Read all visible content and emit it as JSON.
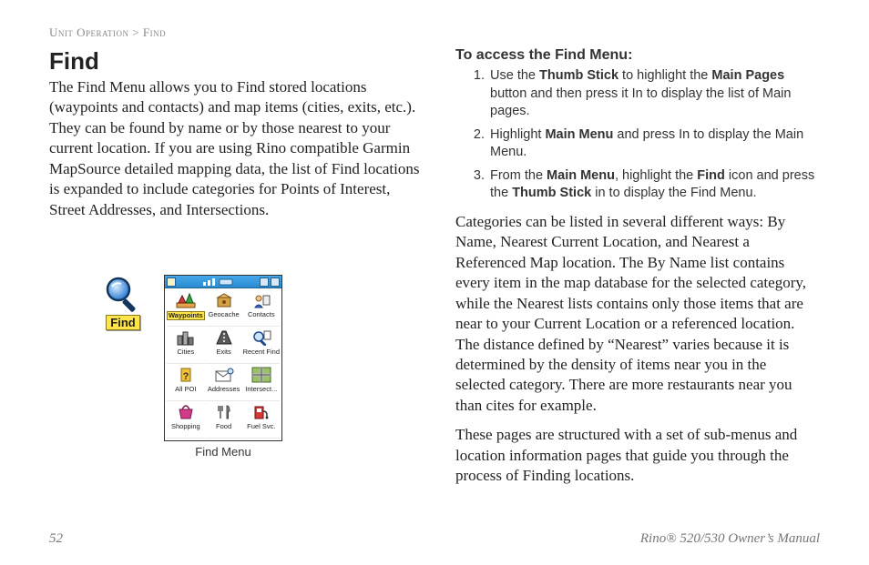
{
  "breadcrumb": "Unit Operation > Find",
  "left": {
    "title": "Find",
    "body": "The Find Menu allows you to Find stored locations (waypoints and contacts) and map items (cities, exits, etc.). They can be found by name or by those nearest to your current location. If you are using Rino compatible Garmin MapSource detailed mapping data, the list of Find locations is expanded to include categories for Points of Interest, Street Addresses, and Intersections.",
    "find_icon_label": "Find",
    "menu_caption": "Find Menu",
    "menu_items": [
      {
        "name": "waypoints",
        "label": "Waypoints",
        "highlight": true
      },
      {
        "name": "geocache",
        "label": "Geocache",
        "highlight": false
      },
      {
        "name": "contacts",
        "label": "Contacts",
        "highlight": false
      },
      {
        "name": "cities",
        "label": "Cities",
        "highlight": false
      },
      {
        "name": "exits",
        "label": "Exits",
        "highlight": false
      },
      {
        "name": "recent-find",
        "label": "Recent Find",
        "highlight": false
      },
      {
        "name": "all-poi",
        "label": "All POI",
        "highlight": false
      },
      {
        "name": "addresses",
        "label": "Addresses",
        "highlight": false
      },
      {
        "name": "intersect",
        "label": "Intersect...",
        "highlight": false
      },
      {
        "name": "shopping",
        "label": "Shopping",
        "highlight": false
      },
      {
        "name": "food",
        "label": "Food",
        "highlight": false
      },
      {
        "name": "fuel-svc",
        "label": "Fuel Svc.",
        "highlight": false
      }
    ]
  },
  "right": {
    "heading": "To access the Find Menu:",
    "steps": [
      {
        "pre": "Use the ",
        "b1": "Thumb Stick",
        "mid1": " to highlight the ",
        "b2": "Main Pages",
        "post": " button and then press it In to display the list of Main pages."
      },
      {
        "pre": "Highlight ",
        "b1": "Main Menu",
        "mid1": " and press In to display the Main Menu.",
        "b2": "",
        "post": ""
      },
      {
        "pre": "From the ",
        "b1": "Main Menu",
        "mid1": ", highlight the ",
        "b2": "Find",
        "mid2": " icon and press the ",
        "b3": "Thumb Stick",
        "post": " in to display the Find Menu."
      }
    ],
    "para1": "Categories can be listed in several different ways: By Name, Nearest Current Location, and Nearest a Referenced Map location. The By Name list contains every item in the map database for the selected category, while the Nearest lists contains only those items that are near to your Current Location or a referenced location. The distance defined by “Nearest” varies because it is determined by the density of items near you in the selected category. There are more restaurants near you than cites for example.",
    "para2": "These pages are structured with a set of sub-menus and location information pages that guide you through the process of Finding locations."
  },
  "footer": {
    "page": "52",
    "manual": "Rino® 520/530 Owner’s Manual"
  }
}
